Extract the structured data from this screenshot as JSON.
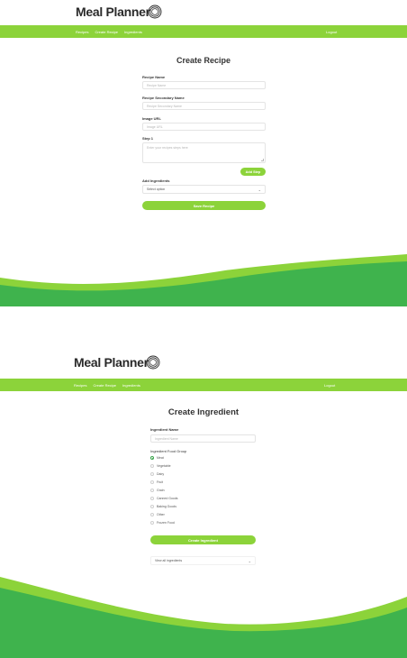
{
  "brand": {
    "name": "Meal Planner"
  },
  "nav": {
    "links": [
      "Recipes",
      "Create Recipe",
      "Ingredients"
    ],
    "logout": "Logout"
  },
  "colors": {
    "accent": "#8cd33a",
    "wave_dark": "#3fb34d",
    "radio_checked": "#3aa44a"
  },
  "recipe_form": {
    "title": "Create Recipe",
    "name_label": "Recipe Name",
    "name_placeholder": "Recipe Name",
    "secondary_label": "Recipe Secondary Name",
    "secondary_placeholder": "Recipe Secondary Name",
    "image_label": "Image URL",
    "image_placeholder": "Image URL",
    "step_label": "Step 1",
    "step_placeholder": "Enter your recipes steps here",
    "add_step_label": "Add Step",
    "ingredients_label": "Add Ingredients",
    "ingredients_select": "Select option",
    "save_label": "Save Recipe"
  },
  "ingredient_form": {
    "title": "Create Ingredient",
    "name_label": "Ingredient Name",
    "name_placeholder": "Ingredient Name",
    "group_label": "Ingredient Food Group",
    "groups": [
      "Meat",
      "Vegetable",
      "Dairy",
      "Fruit",
      "Grain",
      "Canned Goods",
      "Baking Goods",
      "Other",
      "Frozen Food"
    ],
    "selected_group": "Meat",
    "create_label": "Create Ingredient",
    "view_all_label": "View all ingredients"
  }
}
